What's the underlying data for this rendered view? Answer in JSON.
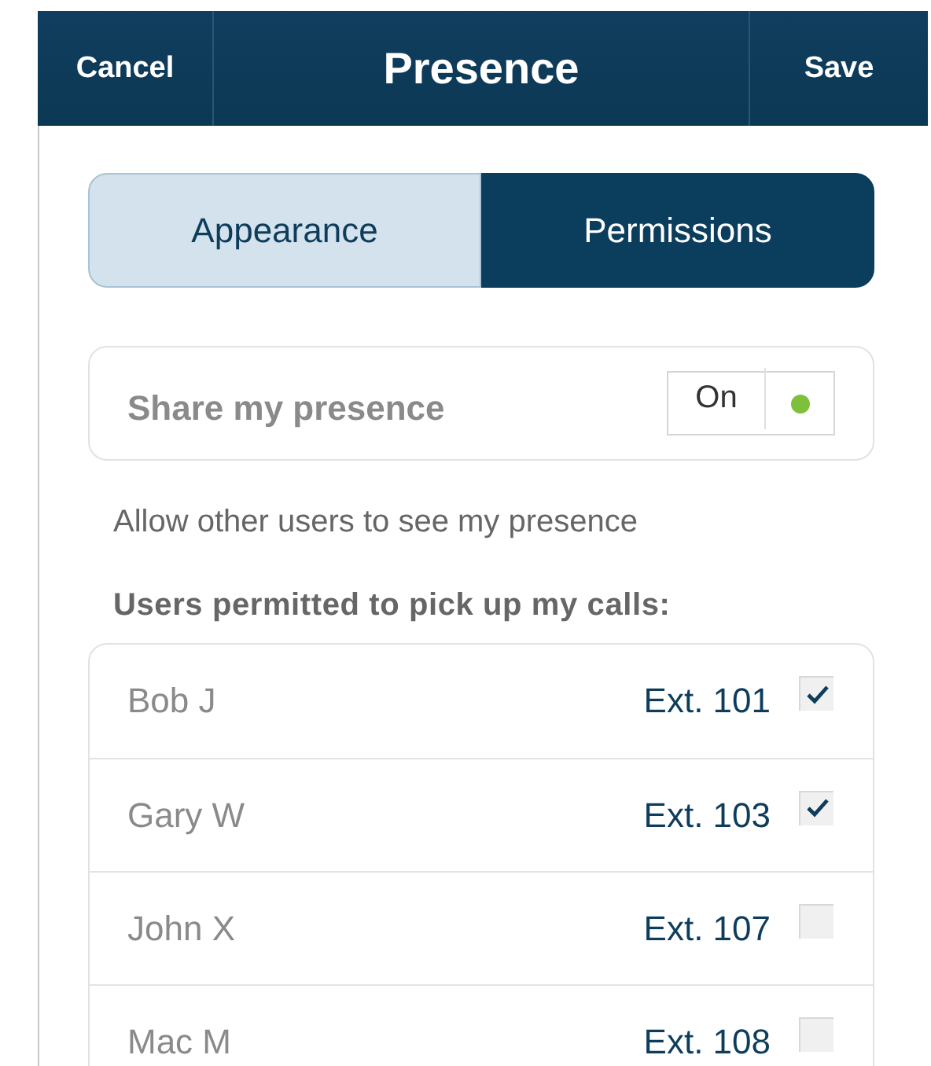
{
  "header": {
    "cancel": "Cancel",
    "title": "Presence",
    "save": "Save"
  },
  "tabs": [
    {
      "label": "Appearance",
      "selected": false
    },
    {
      "label": "Permissions",
      "selected": true
    }
  ],
  "share": {
    "label": "Share my presence",
    "toggle_text": "On",
    "on": true
  },
  "description": "Allow other users to see my presence",
  "users_heading": "Users permitted to pick up my calls:",
  "users": [
    {
      "name": "Bob J",
      "ext": "Ext. 101",
      "checked": true
    },
    {
      "name": "Gary W",
      "ext": "Ext. 103",
      "checked": true
    },
    {
      "name": "John X",
      "ext": "Ext. 107",
      "checked": false
    },
    {
      "name": "Mac M",
      "ext": "Ext. 108",
      "checked": false
    }
  ]
}
